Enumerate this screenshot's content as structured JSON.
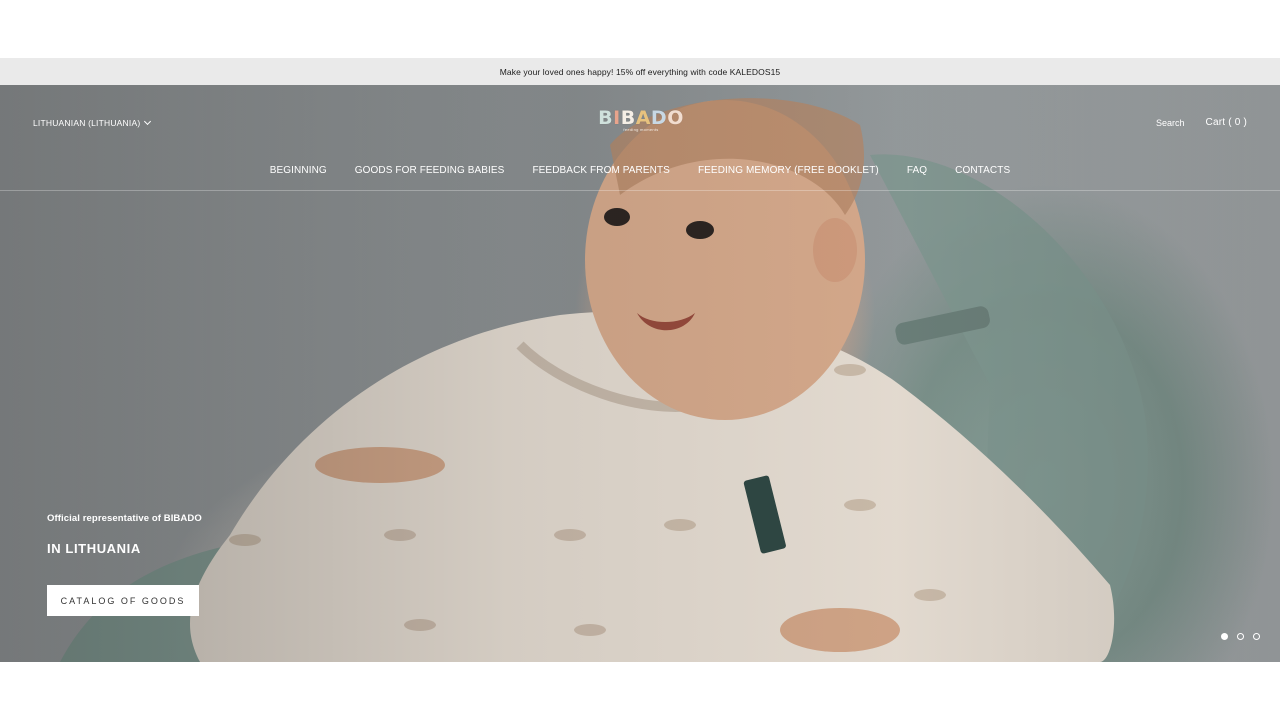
{
  "announcement": {
    "text": "Make your loved ones happy! 15% off everything with code KALEDOS15"
  },
  "header": {
    "language": "LITHUANIAN (LITHUANIA)",
    "logo": {
      "word_letters": [
        "B",
        "I",
        "B",
        "A",
        "D",
        "O"
      ],
      "tagline": "feeding moments"
    },
    "search_label": "Search",
    "cart_label": "Cart ( 0 )"
  },
  "nav": {
    "items": [
      {
        "label": "BEGINNING"
      },
      {
        "label": "GOODS FOR FEEDING BABIES"
      },
      {
        "label": "FEEDBACK FROM PARENTS"
      },
      {
        "label": "FEEDING MEMORY (FREE BOOKLET)"
      },
      {
        "label": "FAQ"
      },
      {
        "label": "CONTACTS"
      }
    ]
  },
  "hero": {
    "subtitle": "Official representative of BIBADO",
    "title": "IN LITHUANIA",
    "cta_label": "CATALOG OF GOODS",
    "slides_total": 3,
    "active_slide": 1
  },
  "colors": {
    "announcement_bg": "#eaeaea",
    "text_on_hero": "#ffffff",
    "cta_bg": "#ffffff"
  }
}
